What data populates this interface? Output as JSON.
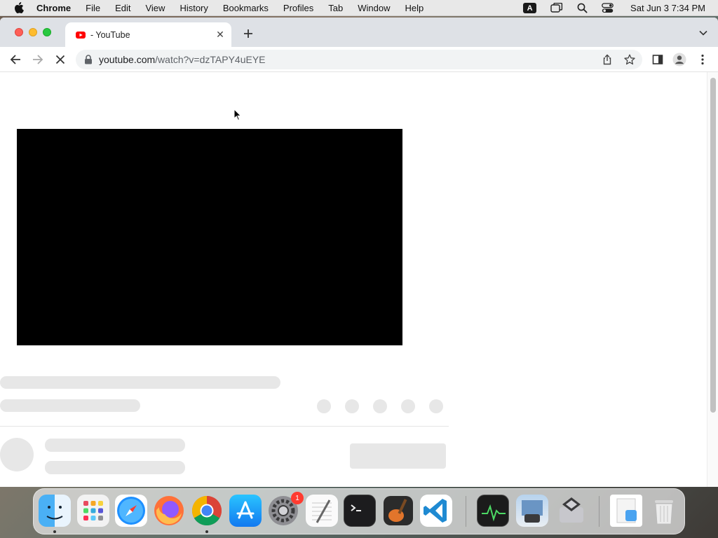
{
  "menubar": {
    "app_name": "Chrome",
    "items": [
      "File",
      "Edit",
      "View",
      "History",
      "Bookmarks",
      "Profiles",
      "Tab",
      "Window",
      "Help"
    ],
    "input_source": "A",
    "clock": "Sat Jun 3  7:34 PM"
  },
  "browser": {
    "tab": {
      "title": "- YouTube",
      "favicon": "youtube-icon"
    },
    "omnibox": {
      "domain": "youtube.com",
      "path": "/watch?v=dzTAPY4uEYE"
    },
    "loading": true
  },
  "colors": {
    "youtube_red": "#ff0000",
    "skeleton": "#e7e7e7",
    "player": "#000000"
  },
  "dock": {
    "apps": [
      "finder-icon",
      "launchpad-icon",
      "safari-icon",
      "firefox-icon",
      "chrome-icon",
      "app-store-icon",
      "system-preferences-icon",
      "textedit-icon",
      "terminal-icon",
      "garageband-icon",
      "vscode-icon",
      "activity-monitor-icon",
      "preview-icon",
      "boot-camp-icon",
      "downloads-icon",
      "trash-icon"
    ],
    "system_preferences_badge": "1"
  }
}
